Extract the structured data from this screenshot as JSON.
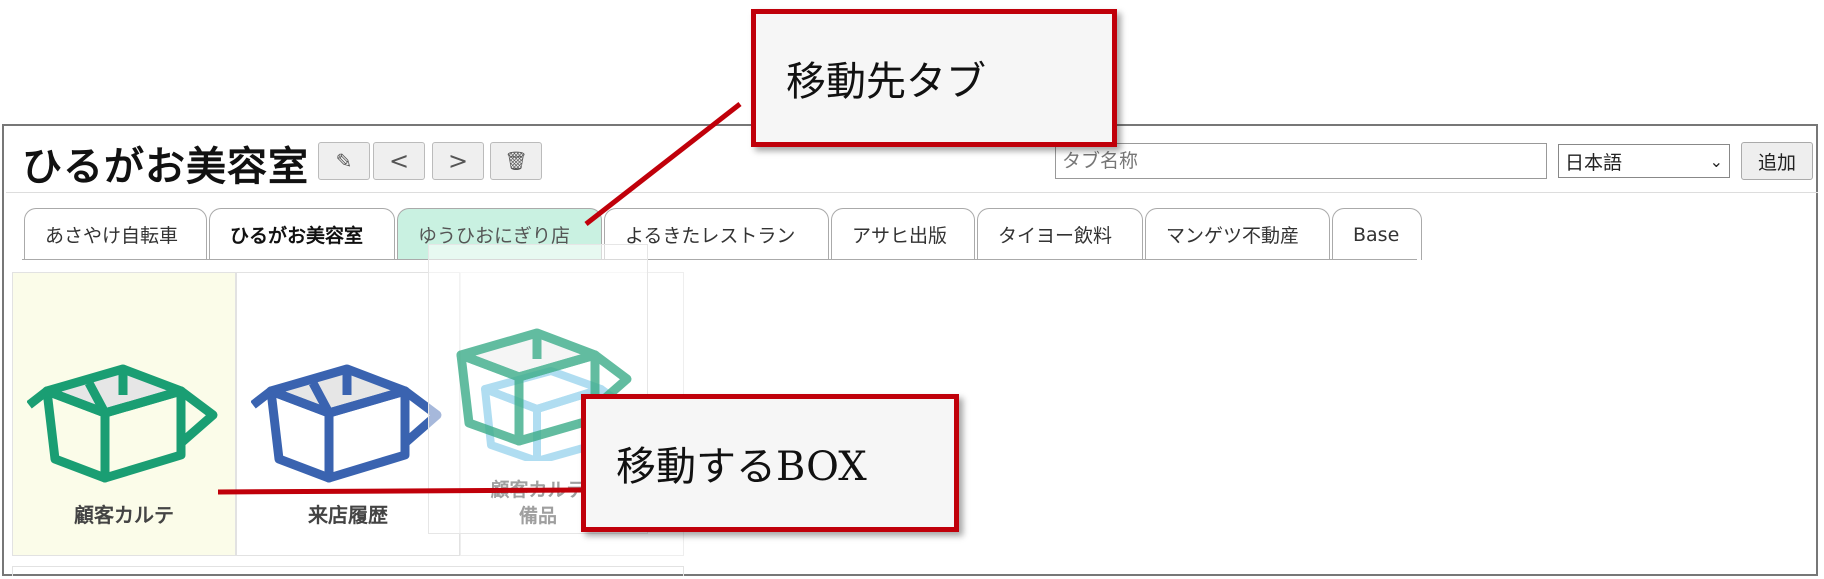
{
  "header": {
    "title": "ひるがお美容室",
    "tabname_placeholder": "タブ名称",
    "language": "日本語",
    "add_label": "追加",
    "edit_glyph": "✎",
    "prev_glyph": "<",
    "next_glyph": ">",
    "delete_glyph": "🗑"
  },
  "tabs": [
    {
      "label": "あさやけ自転車"
    },
    {
      "label": "ひるがお美容室"
    },
    {
      "label": "ゆうひおにぎり店"
    },
    {
      "label": "よるきたレストラン"
    },
    {
      "label": "アサヒ出版"
    },
    {
      "label": "タイヨー飲料"
    },
    {
      "label": "マンゲツ不動産"
    },
    {
      "label": "Base"
    }
  ],
  "boxes": [
    {
      "label": "顧客カルテ",
      "color": "#1a9e73"
    },
    {
      "label": "来店履歴",
      "color": "#3a63b0"
    }
  ],
  "drag_box": {
    "line1": "顧客カルテ",
    "line2": "備品"
  },
  "callouts": {
    "target_tab": "移動先タブ",
    "moving_box": "移動するBOX"
  },
  "colors": {
    "callout_border": "#c0000a",
    "hover_tab": "#c9f1e1",
    "selected_tile": "#fbfce9"
  }
}
